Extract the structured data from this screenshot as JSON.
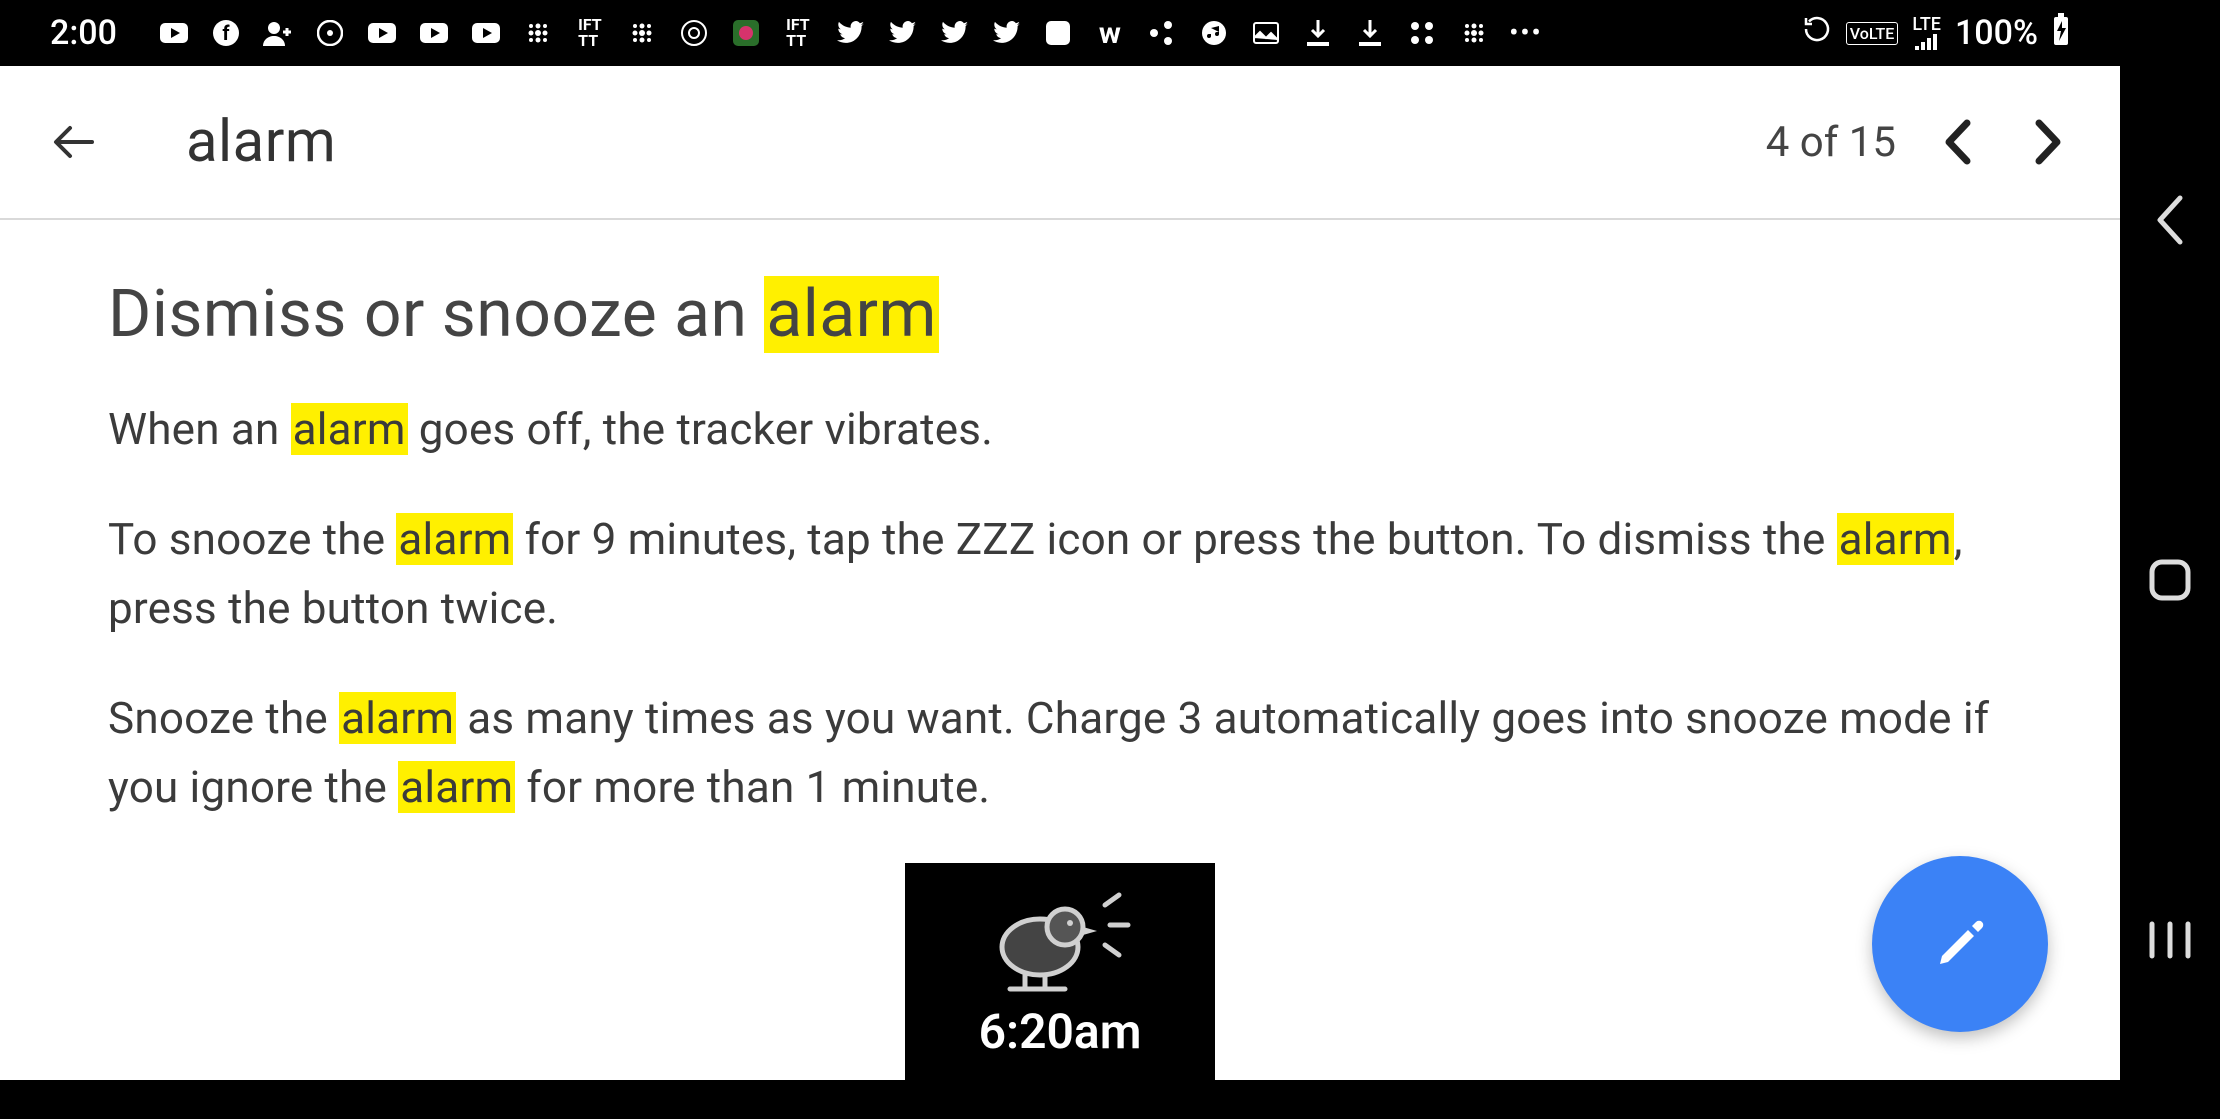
{
  "status": {
    "time": "2:00",
    "volte": "VoLTE",
    "lte": "LTE",
    "battery": "100%"
  },
  "search": {
    "term": "alarm",
    "result_counter": "4 of 15"
  },
  "article": {
    "heading_pre": "Dismiss or snooze an ",
    "heading_hl": "alarm",
    "p1_a": "When an ",
    "p1_hl1": "alarm",
    "p1_b": " goes off, the tracker vibrates.",
    "p2_a": "To snooze the ",
    "p2_hl1": "alarm",
    "p2_b": " for 9 minutes, tap the ZZZ icon or press the button. To dismiss the ",
    "p2_hl2": "alarm",
    "p2_c": ", press the button twice.",
    "p3_a": "Snooze the ",
    "p3_hl1": "alarm",
    "p3_b": " as many times as you want. Charge 3 automatically goes into snooze mode if you ignore the ",
    "p3_hl2": "alarm",
    "p3_c": " for more than 1 minute."
  },
  "device_preview": {
    "time": "6:20am"
  },
  "icons": {
    "back": "arrow-left",
    "prev": "chevron-left",
    "next": "chevron-right",
    "fab": "pencil",
    "rail_back": "chevron-left",
    "rail_square": "square-outline",
    "rail_bars": "triple-bar"
  }
}
